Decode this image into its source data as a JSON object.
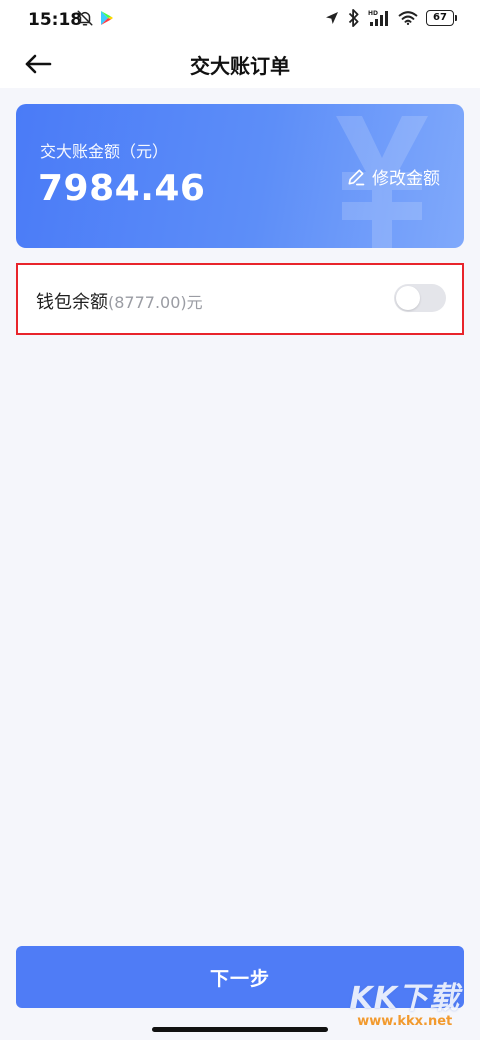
{
  "status_bar": {
    "time": "15:18",
    "left_icons": [
      "bell-off-icon",
      "play-store-icon"
    ],
    "right_icons": [
      "location-icon",
      "bluetooth-icon",
      "hd-signal-icon",
      "wifi-icon"
    ],
    "battery": "67"
  },
  "header": {
    "title": "交大账订单",
    "back_icon": "arrow-left-icon"
  },
  "card": {
    "label": "交大账金额（元）",
    "amount": "7984.46",
    "edit_label": "修改金额",
    "edit_icon": "pencil-icon",
    "watermark_icon": "yen-icon",
    "gradient_start": "#4a7bf7",
    "gradient_end": "#80a9fb"
  },
  "wallet": {
    "label": "钱包余额",
    "balance": "(8777.00)元",
    "toggle_on": false,
    "highlight_color": "#e8242b"
  },
  "footer": {
    "next_label": "下一步",
    "button_color": "#4f7cf6"
  },
  "watermark": {
    "brand": "KK下载",
    "url": "www.kkx.net"
  }
}
